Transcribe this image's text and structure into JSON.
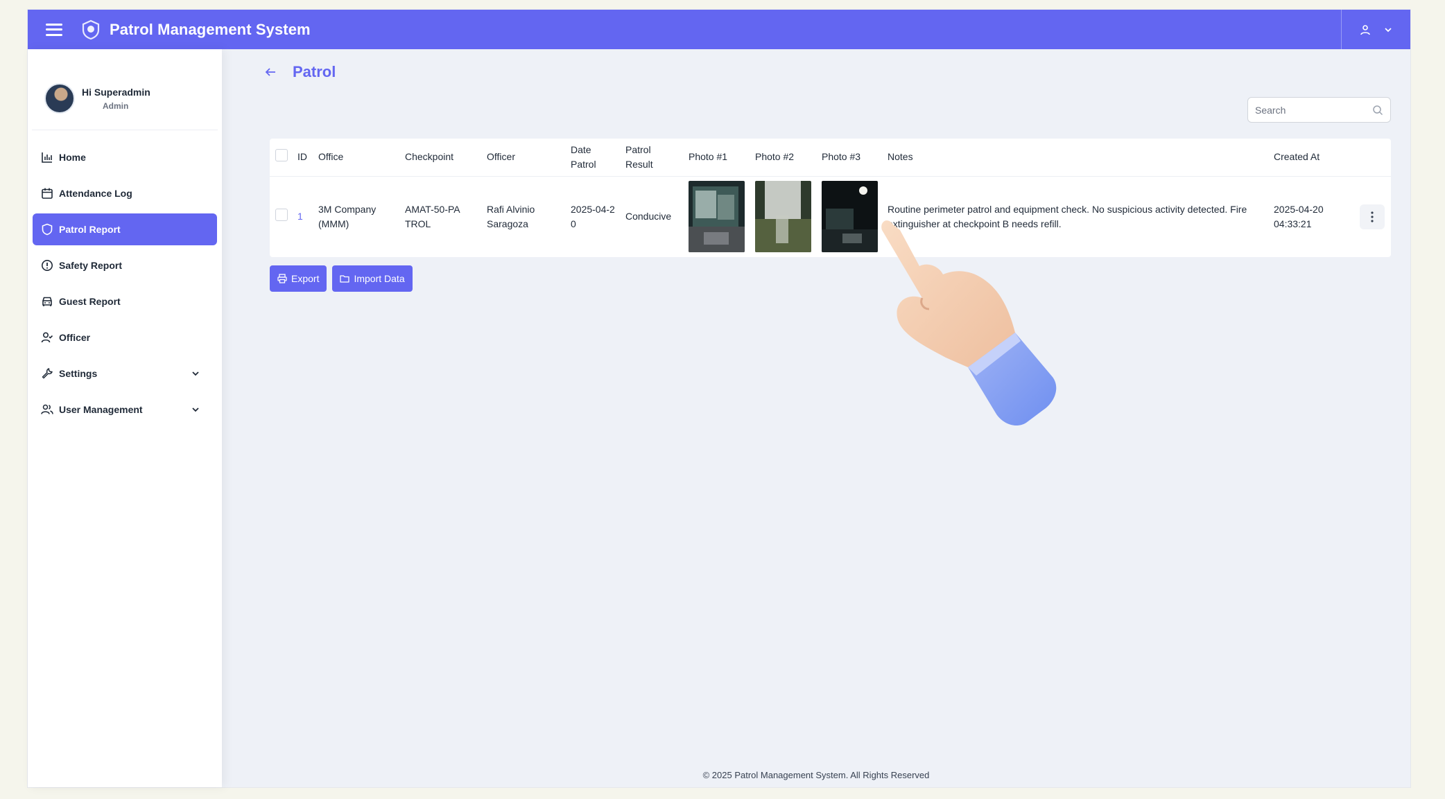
{
  "app": {
    "title": "Patrol Management System"
  },
  "colors": {
    "primary": "#6366f1",
    "background": "#eef1f7"
  },
  "profile": {
    "greeting": "Hi Superadmin",
    "role": "Admin"
  },
  "sidebar": {
    "items": [
      {
        "label": "Home",
        "icon": "chart-icon"
      },
      {
        "label": "Attendance Log",
        "icon": "calendar-icon"
      },
      {
        "label": "Patrol Report",
        "icon": "shield-icon",
        "active": true
      },
      {
        "label": "Safety Report",
        "icon": "alert-circle-icon"
      },
      {
        "label": "Guest Report",
        "icon": "car-icon"
      },
      {
        "label": "Officer",
        "icon": "user-check-icon"
      },
      {
        "label": "Settings",
        "icon": "wrench-icon",
        "expandable": true
      },
      {
        "label": "User Management",
        "icon": "users-icon",
        "expandable": true
      }
    ]
  },
  "page": {
    "title": "Patrol"
  },
  "search": {
    "placeholder": "Search"
  },
  "table": {
    "headers": {
      "id": "ID",
      "office": "Office",
      "checkpoint": "Checkpoint",
      "officer": "Officer",
      "date_patrol": "Date Patrol",
      "patrol_result": "Patrol Result",
      "photo1": "Photo #1",
      "photo2": "Photo #2",
      "photo3": "Photo #3",
      "notes": "Notes",
      "created_at": "Created At"
    },
    "rows": [
      {
        "id": "1",
        "office": "3M Company (MMM)",
        "checkpoint": "AMAT-50-PATROL",
        "officer": "Rafi Alvinio Saragoza",
        "date_patrol": "2025-04-20",
        "patrol_result": "Conducive",
        "notes": "Routine perimeter patrol and equipment check. No suspicious activity detected. Fire extinguisher at checkpoint B needs refill.",
        "created_at": "2025-04-20 04:33:21"
      }
    ]
  },
  "actions": {
    "export_label": "Export",
    "import_label": "Import Data"
  },
  "footer": {
    "text": "© 2025 Patrol Management System. All Rights Reserved"
  }
}
